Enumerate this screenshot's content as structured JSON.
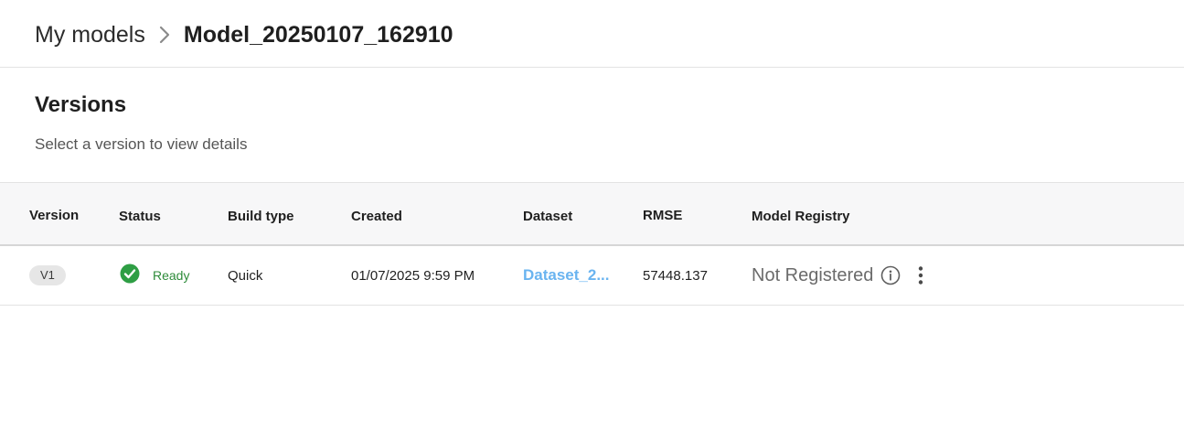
{
  "breadcrumb": {
    "parent_label": "My models",
    "current_label": "Model_20250107_162910"
  },
  "versions": {
    "title": "Versions",
    "subtitle": "Select a version to view details"
  },
  "table": {
    "columns": [
      "Version",
      "Status",
      "Build type",
      "Created",
      "Dataset",
      "RMSE",
      "Model Registry"
    ],
    "rows": [
      {
        "version": "V1",
        "status": "Ready",
        "build_type": "Quick",
        "created": "01/07/2025 9:59 PM",
        "dataset": "Dataset_2...",
        "rmse": "57448.137",
        "model_registry": "Not Registered"
      }
    ]
  },
  "icons": {
    "breadcrumb_separator": "chevron-right-icon",
    "status": "check-circle-icon",
    "registry_info": "info-icon",
    "row_menu": "more-vertical-icon"
  },
  "colors": {
    "status_ready": "#2e8b3a",
    "dataset_link": "#6ab4f0",
    "header_bg": "#f7f7f8"
  }
}
